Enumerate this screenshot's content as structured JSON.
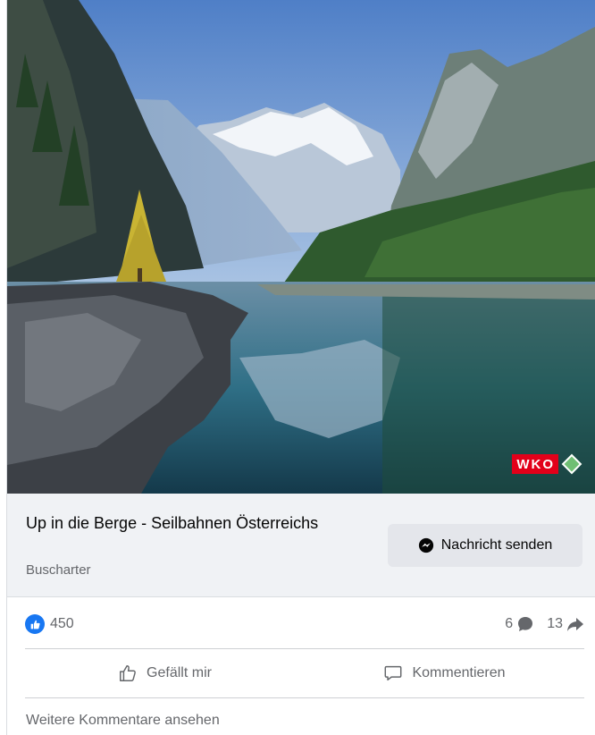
{
  "post": {
    "image_alt": "Bergsee mit Alpenpanorama",
    "watermark": "WKO",
    "link": {
      "title": "Up in die Berge - Seilbahnen Österreichs",
      "subtitle": "Buscharter",
      "button_label": "Nachricht senden"
    },
    "stats": {
      "likes": "450",
      "comments": "6",
      "shares": "13"
    },
    "actions": {
      "like_label": "Gefällt mir",
      "comment_label": "Kommentieren"
    },
    "more_comments_label": "Weitere Kommentare ansehen"
  },
  "colors": {
    "facebook_blue": "#1877f2",
    "secondary_text": "#65676b",
    "link_bar_bg": "#f0f2f5",
    "wko_red": "#e2001a"
  },
  "icons": {
    "message_button": "messenger-icon",
    "like_badge": "thumbs-up-icon",
    "comments": "comment-bubble-icon",
    "shares": "share-arrow-icon",
    "like_action": "thumbs-up-outline-icon",
    "comment_action": "comment-outline-icon"
  }
}
